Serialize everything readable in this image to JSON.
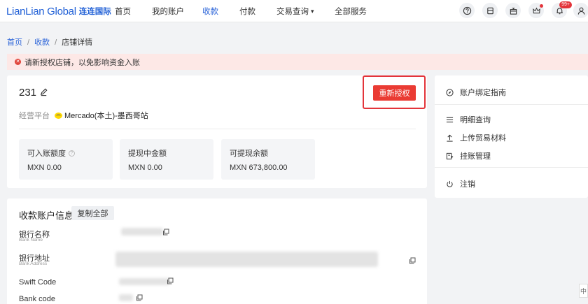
{
  "brand": {
    "name_en": "LianLian Global",
    "name_cn": "连连国际"
  },
  "nav": {
    "items": [
      {
        "label": "首页"
      },
      {
        "label": "我的账户"
      },
      {
        "label": "收款"
      },
      {
        "label": "付款"
      },
      {
        "label": "交易查询"
      },
      {
        "label": "全部服务"
      }
    ],
    "notification_count": "99+"
  },
  "breadcrumb": {
    "home": "首页",
    "receive": "收款",
    "current": "店铺详情"
  },
  "alert": {
    "message": "请新授权店铺，以免影响资金入账"
  },
  "store": {
    "name": "231",
    "reauth_label": "重新授权",
    "platform_label": "经营平台",
    "platform_name": "Mercado(本土)-墨西哥站"
  },
  "stats": [
    {
      "label": "可入账额度",
      "value": "MXN 0.00"
    },
    {
      "label": "提现中金额",
      "value": "MXN 0.00"
    },
    {
      "label": "可提现余额",
      "value": "MXN 673,800.00"
    }
  ],
  "account": {
    "title": "收款账户信息",
    "copy_all_label": "复制全部",
    "fields": [
      {
        "label": "银行名称",
        "sub": "Bank Name"
      },
      {
        "label": "银行地址",
        "sub": "Bank Address"
      },
      {
        "label": "Swift Code",
        "sub": ""
      },
      {
        "label": "Bank code",
        "sub": ""
      }
    ]
  },
  "sidebar": {
    "items": [
      {
        "label": "账户绑定指南",
        "icon": "compass-icon"
      },
      {
        "label": "明细查询",
        "icon": "list-icon"
      },
      {
        "label": "上传贸易材料",
        "icon": "upload-icon"
      },
      {
        "label": "挂账管理",
        "icon": "ledger-icon"
      },
      {
        "label": "注销",
        "icon": "power-icon"
      }
    ]
  },
  "float_tab": "中"
}
